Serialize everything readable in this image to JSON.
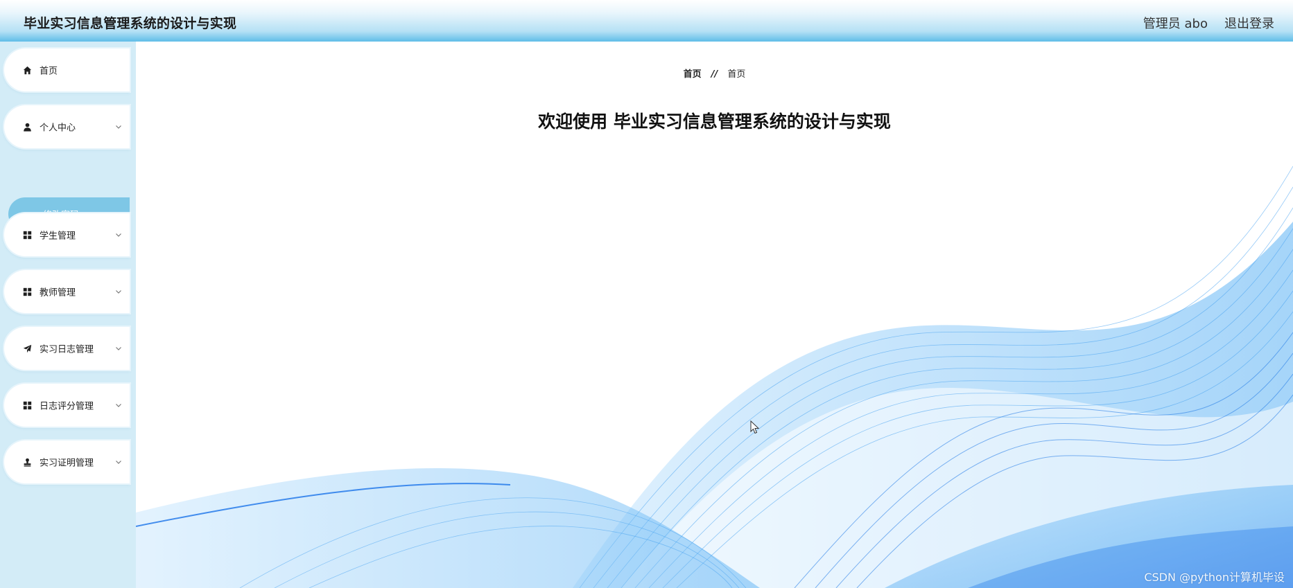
{
  "app": {
    "title": "毕业实习信息管理系统的设计与实现"
  },
  "header": {
    "user_label": "管理员 abo",
    "logout_label": "退出登录"
  },
  "sidebar": {
    "items": [
      {
        "label": "首页",
        "icon": "home-icon"
      },
      {
        "label": "个人中心",
        "icon": "user-icon"
      },
      {
        "label": "学生管理",
        "icon": "grid-icon"
      },
      {
        "label": "教师管理",
        "icon": "grid-icon"
      },
      {
        "label": "实习日志管理",
        "icon": "send-icon"
      },
      {
        "label": "日志评分管理",
        "icon": "grid-icon"
      },
      {
        "label": "实习证明管理",
        "icon": "stamp-icon"
      }
    ],
    "submenu": {
      "label": "修改密码"
    }
  },
  "breadcrumb": {
    "home": "首页",
    "separator": "//",
    "current": "首页"
  },
  "main": {
    "welcome": "欢迎使用 毕业实习信息管理系统的设计与实现"
  },
  "watermark": "CSDN @python计算机毕设",
  "colors": {
    "header_accent": "#5fbde8",
    "sidebar_bg": "#d3ecf7",
    "submenu_active": "#7ec7e6",
    "wave_blue": "#3f9ef0"
  }
}
